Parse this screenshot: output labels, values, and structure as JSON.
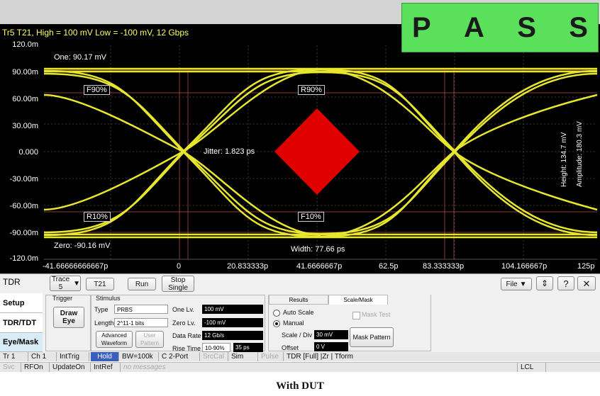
{
  "pass": {
    "letters": [
      "P",
      "A",
      "S",
      "S"
    ],
    "color": "#5be05b"
  },
  "plot": {
    "title": "Tr5 T21, High = 100 mV Low = -100 mV, 12 Gbps",
    "y_ticks": [
      "120.0m",
      "90.00m",
      "60.00m",
      "30.00m",
      "0.000",
      "-30.00m",
      "-60.00m",
      "-90.00m",
      "-120.0m"
    ],
    "x_ticks": [
      "-41.66666666667p",
      "0",
      "20.833333p",
      "41.6666667p",
      "62.5p",
      "83.333333p",
      "104.166667p",
      "125p"
    ],
    "annotations": {
      "one": "One: 90.17 mV",
      "zero": "Zero: -90.16 mV",
      "jitter": "Jitter: 1.823 ps",
      "width": "Width: 77.66 ps",
      "height": "Height: 134.7 mV",
      "amplitude": "Amplitude: 180.3 mV",
      "f90": "F90%",
      "r90": "R90%",
      "r10": "R10%",
      "f10": "F10%"
    },
    "trace_color": "#ffff33",
    "mask_color": "#e00000"
  },
  "toolbar": {
    "tdr": "TDR",
    "trace": "Trace 5",
    "t21": "T21",
    "run": "Run",
    "stop": "Stop Single",
    "file": "File",
    "help": "?",
    "close": "✕"
  },
  "side": {
    "setup": "Setup",
    "tdr_tdt": "TDR/TDT",
    "eye_mask": "Eye/Mask"
  },
  "trigger": {
    "title": "Trigger",
    "draw_eye": "Draw Eye"
  },
  "stimulus": {
    "title": "Stimulus",
    "type_label": "Type",
    "type_value": "PRBS",
    "length_label": "Length",
    "length_value": "2^11-1 bits",
    "one_label": "One Lv.",
    "one_value": "100 mV",
    "zero_label": "Zero Lv.",
    "zero_value": "-100 mV",
    "rate_label": "Data Rate",
    "rate_value": "12 Gb/s",
    "rise_label": "Rise Time",
    "rise_select": "10-90%",
    "rise_value": "35 ps",
    "advanced": "Advanced Waveform",
    "user_pattern": "User Pattern"
  },
  "scale": {
    "tab_results": "Results",
    "tab_scale": "Scale/Mask",
    "auto": "Auto Scale",
    "manual": "Manual",
    "div_label": "Scale / Div",
    "div_value": "30 mV",
    "offset_label": "Offset",
    "offset_value": "0 V",
    "mask_test": "Mask Test",
    "mask_pattern": "Mask Pattern"
  },
  "status1": [
    "Tr 1",
    "Ch 1",
    "IntTrig",
    "Hold",
    "BW=100k",
    "C  2-Port",
    "SrcCal",
    "Sim",
    "Pulse",
    "TDR [Full] |Zr | Tform"
  ],
  "status2": [
    "Svc",
    "RFOn",
    "UpdateOn",
    "IntRef",
    "no messages",
    "LCL"
  ],
  "caption": "With DUT"
}
